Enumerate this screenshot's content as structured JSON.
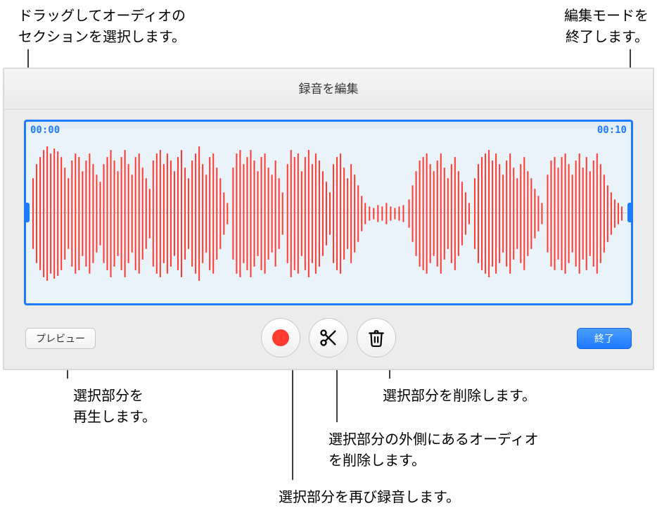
{
  "callouts": {
    "drag_select": "ドラッグしてオーディオの\nセクションを選択します。",
    "exit_edit": "編集モードを\n終了します。",
    "preview": "選択部分を\n再生します。",
    "rerecord": "選択部分を再び録音します。",
    "trim": "選択部分の外側にあるオーディオ\nを削除します。",
    "delete": "選択部分を削除します。"
  },
  "editor": {
    "title": "録音を編集",
    "time_start": "00:00",
    "time_end": "00:10",
    "preview_button": "プレビュー",
    "done_button": "終了"
  },
  "icons": {
    "record": "record-icon",
    "cut": "scissors-icon",
    "trash": "trash-icon"
  }
}
